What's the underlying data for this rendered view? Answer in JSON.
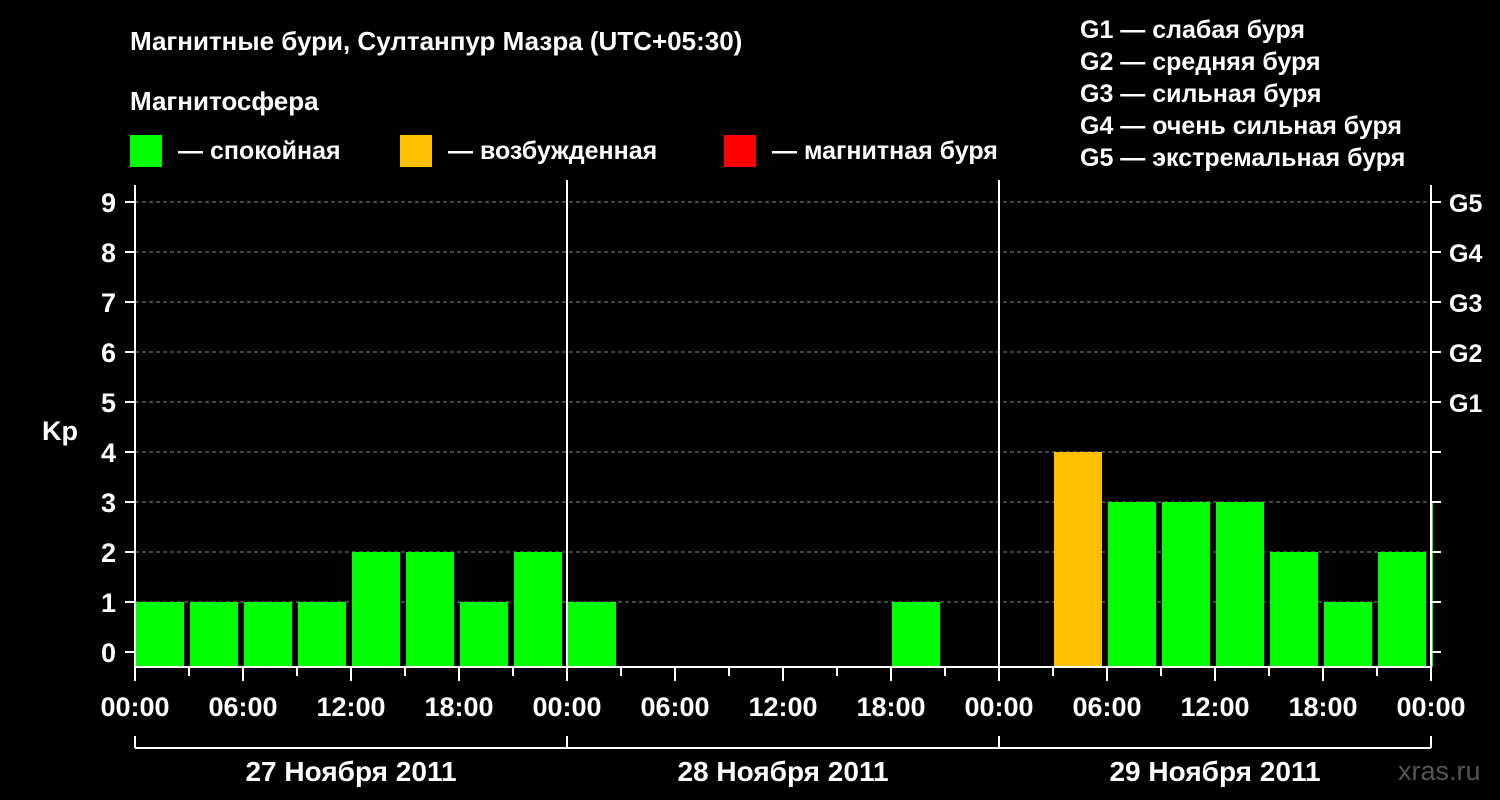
{
  "header": {
    "title": "Магнитные бури, Султанпур Мазра (UTC+05:30)",
    "subtitle": "Магнитосфера"
  },
  "legend": [
    {
      "label": "— спокойная",
      "color": "#00ff00"
    },
    {
      "label": "— возбужденная",
      "color": "#ffc000"
    },
    {
      "label": "— магнитная буря",
      "color": "#ff0000"
    }
  ],
  "storm_scale": [
    "G1 — слабая буря",
    "G2 — средняя буря",
    "G3 — сильная буря",
    "G4 — очень сильная буря",
    "G5 — экстремальная буря"
  ],
  "watermark": "xras.ru",
  "chart_data": {
    "type": "bar",
    "ylabel": "Kp",
    "ylim": [
      0,
      9
    ],
    "y_ticks": [
      0,
      1,
      2,
      3,
      4,
      5,
      6,
      7,
      8,
      9
    ],
    "right_axis_labels": [
      {
        "kp": 5,
        "label": "G1"
      },
      {
        "kp": 6,
        "label": "G2"
      },
      {
        "kp": 7,
        "label": "G3"
      },
      {
        "kp": 8,
        "label": "G4"
      },
      {
        "kp": 9,
        "label": "G5"
      }
    ],
    "x_tick_labels": [
      "00:00",
      "06:00",
      "12:00",
      "18:00",
      "00:00",
      "06:00",
      "12:00",
      "18:00",
      "00:00",
      "06:00",
      "12:00",
      "18:00",
      "00:00"
    ],
    "days": [
      "27 Ноября 2011",
      "28 Ноября 2011",
      "29 Ноября 2011"
    ],
    "bars": [
      {
        "start_hour": 0,
        "kp": 1,
        "level": "calm"
      },
      {
        "start_hour": 3,
        "kp": 1,
        "level": "calm"
      },
      {
        "start_hour": 6,
        "kp": 1,
        "level": "calm"
      },
      {
        "start_hour": 9,
        "kp": 1,
        "level": "calm"
      },
      {
        "start_hour": 12,
        "kp": 2,
        "level": "calm"
      },
      {
        "start_hour": 15,
        "kp": 2,
        "level": "calm"
      },
      {
        "start_hour": 18,
        "kp": 1,
        "level": "calm"
      },
      {
        "start_hour": 21,
        "kp": 2,
        "level": "calm"
      },
      {
        "start_hour": 24,
        "kp": 1,
        "level": "calm"
      },
      {
        "start_hour": 42,
        "kp": 1,
        "level": "calm"
      },
      {
        "start_hour": 51,
        "kp": 4,
        "level": "disturbed"
      },
      {
        "start_hour": 54,
        "kp": 3,
        "level": "calm"
      },
      {
        "start_hour": 57,
        "kp": 3,
        "level": "calm"
      },
      {
        "start_hour": 60,
        "kp": 3,
        "level": "calm"
      },
      {
        "start_hour": 63,
        "kp": 2,
        "level": "calm"
      },
      {
        "start_hour": 66,
        "kp": 1,
        "level": "calm"
      },
      {
        "start_hour": 69,
        "kp": 2,
        "level": "calm"
      },
      {
        "start_hour": 72,
        "kp": 3,
        "level": "calm"
      }
    ],
    "colors": {
      "calm": "#00ff00",
      "disturbed": "#ffc000",
      "storm": "#ff0000"
    },
    "grid": "dashed horizontal at Kp 1–9"
  }
}
